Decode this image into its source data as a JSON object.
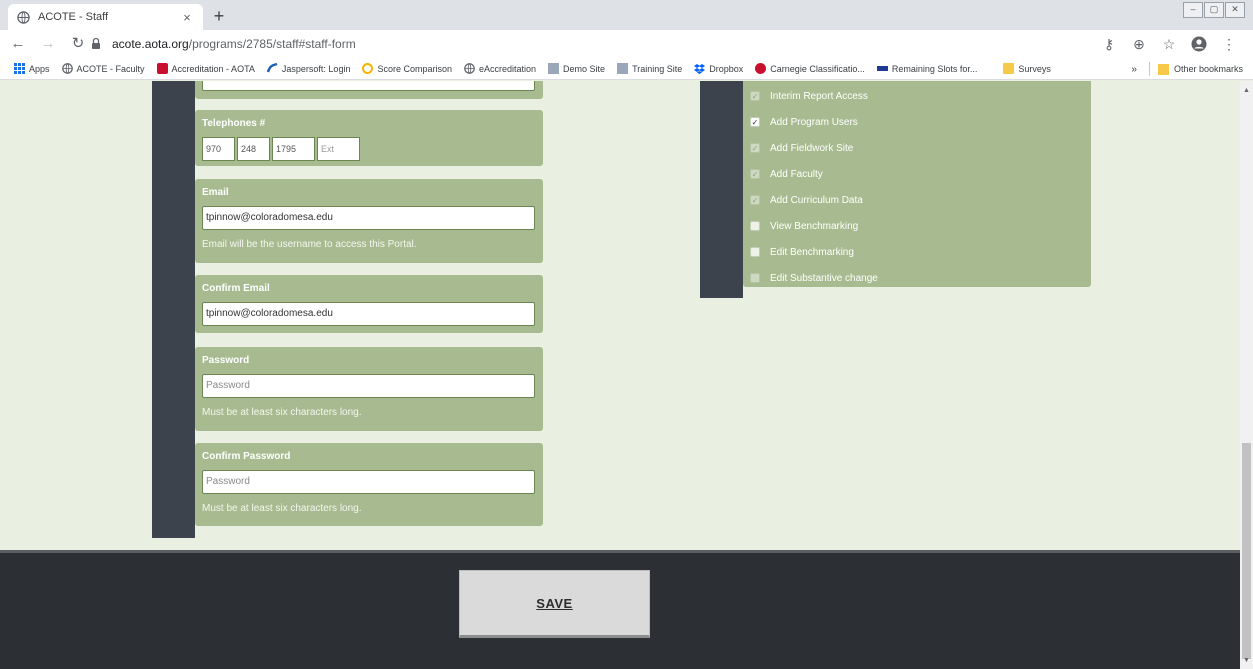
{
  "browser": {
    "tab_title": "ACOTE - Staff",
    "tab_close": "×",
    "new_tab": "+",
    "url_host": "acote.aota.org",
    "url_path": "/programs/2785/staff#staff-form",
    "window_controls": [
      "–",
      "▢",
      "✕"
    ]
  },
  "bookmarks": {
    "items": [
      {
        "label": "Apps",
        "icon": "apps-grid-icon"
      },
      {
        "label": "ACOTE - Faculty",
        "icon": "globe-icon"
      },
      {
        "label": "Accreditation - AOTA",
        "icon": "aota-logo-icon"
      },
      {
        "label": "Jaspersoft: Login",
        "icon": "jaspersoft-icon"
      },
      {
        "label": "Score Comparison",
        "icon": "circle-icon"
      },
      {
        "label": "eAccreditation",
        "icon": "globe-icon"
      },
      {
        "label": "Demo Site",
        "icon": "site-icon"
      },
      {
        "label": "Training Site",
        "icon": "site-icon"
      },
      {
        "label": "Dropbox",
        "icon": "dropbox-icon"
      },
      {
        "label": "Carnegie Classificatio...",
        "icon": "carnegie-icon"
      },
      {
        "label": "Remaining Slots for...",
        "icon": "aota-text-icon"
      },
      {
        "label": "Surveys",
        "icon": "folder-icon"
      }
    ],
    "overflow": "»",
    "other": "Other bookmarks"
  },
  "form": {
    "telephone": {
      "label": "Telephones #",
      "area": "970",
      "prefix": "248",
      "line": "1795",
      "ext_placeholder": "Ext"
    },
    "email": {
      "label": "Email",
      "value": "tpinnow@coloradomesa.edu",
      "help": "Email will be the username to access this Portal."
    },
    "confirm_email": {
      "label": "Confirm Email",
      "value": "tpinnow@coloradomesa.edu"
    },
    "password": {
      "label": "Password",
      "placeholder": "Password",
      "help": "Must be at least six characters long."
    },
    "confirm_password": {
      "label": "Confirm Password",
      "placeholder": "Password",
      "help": "Must be at least six characters long."
    }
  },
  "permissions": [
    {
      "label": "Interim Report Access",
      "checked": true
    },
    {
      "label": "Add Program Users",
      "checked": true
    },
    {
      "label": "Add Fieldwork Site",
      "checked": true
    },
    {
      "label": "Add Faculty",
      "checked": true
    },
    {
      "label": "Add Curriculum Data",
      "checked": true
    },
    {
      "label": "View Benchmarking",
      "checked": false
    },
    {
      "label": "Edit Benchmarking",
      "checked": false
    },
    {
      "label": "Edit Substantive change",
      "checked": false
    }
  ],
  "footer": {
    "save_label": "SAVE"
  },
  "colors": {
    "field_bg": "#a8bb90",
    "page_bg": "#e9efe1",
    "dark_column": "#3c434c",
    "footer_bg": "#2c2f33"
  }
}
